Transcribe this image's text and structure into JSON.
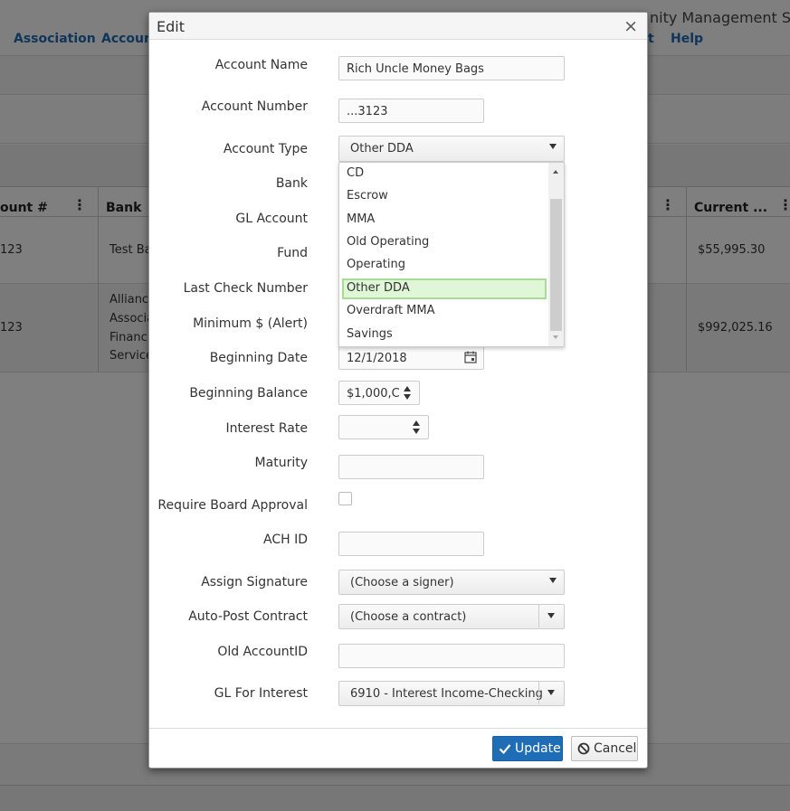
{
  "app": {
    "title_fragment": "nity Management Sp",
    "nav": [
      "Association",
      "Accoun",
      "t",
      "Help"
    ],
    "table": {
      "columns": [
        "ount #",
        "Bank",
        "Current ..."
      ],
      "rows": [
        {
          "account": "123",
          "bank": "Test Ba",
          "current": "$55,995.30"
        },
        {
          "account": "123",
          "bank_lines": [
            "Alliance",
            "Associa",
            "Financi",
            "Service"
          ],
          "current": "$992,025.16"
        }
      ]
    }
  },
  "modal": {
    "title": "Edit",
    "close_glyph": "×",
    "fields": {
      "account_name": {
        "label": "Account Name",
        "value": "Rich Uncle Money Bags"
      },
      "account_number": {
        "label": "Account Number",
        "value": "...3123"
      },
      "account_type": {
        "label": "Account Type",
        "value": "Other DDA"
      },
      "bank": {
        "label": "Bank"
      },
      "gl_account": {
        "label": "GL Account"
      },
      "fund": {
        "label": "Fund"
      },
      "last_check_number": {
        "label": "Last Check Number"
      },
      "minimum_alert": {
        "label": "Minimum $ (Alert)"
      },
      "beginning_date": {
        "label": "Beginning Date",
        "value": "12/1/2018"
      },
      "beginning_balance": {
        "label": "Beginning Balance",
        "value": "$1,000,C"
      },
      "interest_rate": {
        "label": "Interest Rate",
        "value": ""
      },
      "maturity": {
        "label": "Maturity",
        "value": ""
      },
      "require_board_approval": {
        "label": "Require Board Approval",
        "checked": false
      },
      "ach_id": {
        "label": "ACH ID",
        "value": ""
      },
      "assign_signature": {
        "label": "Assign Signature",
        "value": "(Choose a signer)"
      },
      "auto_post_contract": {
        "label": "Auto-Post Contract",
        "value": "(Choose a contract)"
      },
      "old_account_id": {
        "label": "Old AccountID",
        "value": ""
      },
      "gl_for_interest": {
        "label": "GL For Interest",
        "value": "6910 - Interest Income-Checking"
      }
    },
    "account_type_options": [
      "CD",
      "Escrow",
      "MMA",
      "Old Operating",
      "Operating",
      "Other DDA",
      "Overdraft MMA",
      "Savings"
    ],
    "selected_option": "Other DDA",
    "buttons": {
      "update": "Update",
      "cancel": "Cancel"
    }
  },
  "colors": {
    "primary": "#1f6db5",
    "highlight": "#dff6d7",
    "highlight_border": "#a7dc97",
    "nav_link": "#1f6db5"
  }
}
